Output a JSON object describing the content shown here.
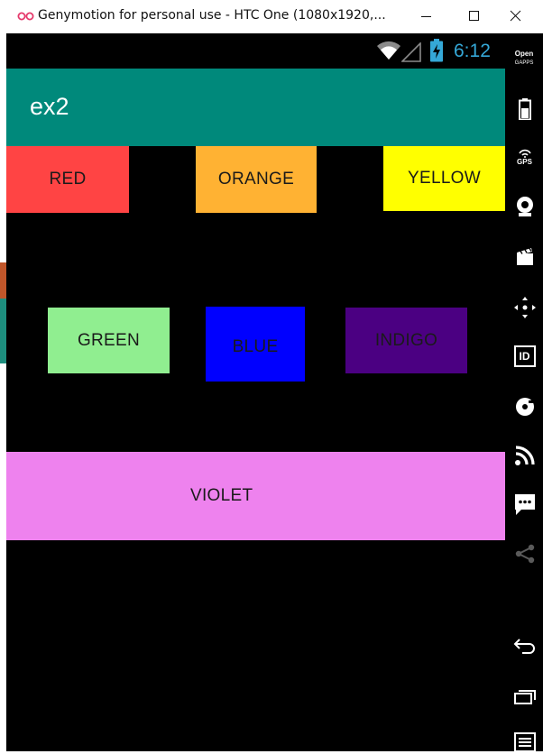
{
  "window": {
    "title": "Genymotion for personal use - HTC One (1080x1920,...",
    "logo_icon": "genymotion-logo-icon",
    "controls": [
      "minimize-icon",
      "maximize-icon",
      "close-icon"
    ]
  },
  "status_bar": {
    "time": "6:12",
    "icons": [
      "wifi-icon",
      "signal-icon",
      "battery-charging-icon"
    ],
    "clock_color": "#35a8d7"
  },
  "app_bar": {
    "title": "ex2",
    "color": "#00897b"
  },
  "buttons": [
    {
      "label": "RED",
      "color": "#ff4444"
    },
    {
      "label": "ORANGE",
      "color": "#ffb233"
    },
    {
      "label": "YELLOW",
      "color": "#ffff00"
    },
    {
      "label": "GREEN",
      "color": "#90ee90"
    },
    {
      "label": "BLUE",
      "color": "#0000ff"
    },
    {
      "label": "INDIGO",
      "color": "#4b0082"
    },
    {
      "label": "VIOLET",
      "color": "#ee82ee"
    }
  ],
  "side_toolbar": {
    "gapps_label_top": "Open",
    "gapps_label_bottom": "GAPPS",
    "gps_label": "GPS",
    "id_label": "ID",
    "icons": [
      "open-gapps-icon",
      "battery-icon",
      "gps-icon",
      "webcam-icon",
      "screencast-icon",
      "move-icon",
      "device-id-icon",
      "disk-icon",
      "rss-icon",
      "sms-icon",
      "share-icon",
      "back-icon",
      "recent-apps-icon",
      "menu-icon"
    ]
  }
}
